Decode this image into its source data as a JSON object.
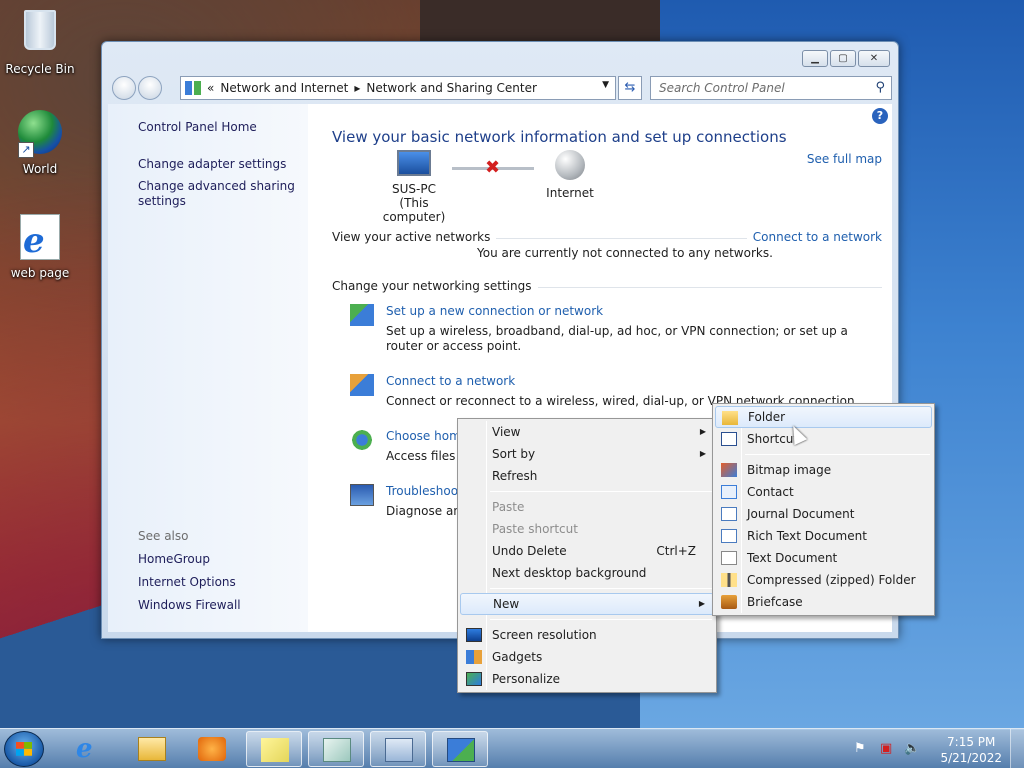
{
  "desktop": {
    "icons": [
      {
        "label": "Recycle Bin",
        "icon": "recycle-bin-icon"
      },
      {
        "label": "World",
        "icon": "globe-shortcut-icon"
      },
      {
        "label": "web page",
        "icon": "internet-explorer-document-icon"
      }
    ]
  },
  "window": {
    "breadcrumb": {
      "prefix": "«",
      "items": [
        "Network and Internet",
        "Network and Sharing Center"
      ],
      "separator": "▸"
    },
    "search_placeholder": "Search Control Panel",
    "left_links": [
      "Control Panel Home",
      "Change adapter settings",
      "Change advanced sharing settings"
    ],
    "see_also": {
      "heading": "See also",
      "links": [
        "HomeGroup",
        "Internet Options",
        "Windows Firewall"
      ]
    },
    "main": {
      "title": "View your basic network information and set up connections",
      "see_full_map": "See full map",
      "computer_name": "SUS-PC",
      "computer_sub": "(This computer)",
      "internet_label": "Internet",
      "active_networks_label": "View your active networks",
      "connect_link": "Connect to a network",
      "not_connected": "You are currently not connected to any networks.",
      "change_settings_label": "Change your networking settings",
      "tasks": [
        {
          "title": "Set up a new connection or network",
          "desc": "Set up a wireless, broadband, dial-up, ad hoc, or VPN connection; or set up a router or access point."
        },
        {
          "title": "Connect to a network",
          "desc": "Connect or reconnect to a wireless, wired, dial-up, or VPN network connection."
        },
        {
          "title": "Choose home",
          "desc": "Access files an"
        },
        {
          "title": "Troubleshoot",
          "desc": "Diagnose and"
        }
      ]
    }
  },
  "context_menu": {
    "items": [
      {
        "label": "View",
        "submenu": true
      },
      {
        "label": "Sort by",
        "submenu": true
      },
      {
        "label": "Refresh"
      },
      {
        "label": "Paste",
        "disabled": true
      },
      {
        "label": "Paste shortcut",
        "disabled": true
      },
      {
        "label": "Undo Delete",
        "shortcut": "Ctrl+Z"
      },
      {
        "label": "Next desktop background"
      },
      {
        "label": "New",
        "submenu": true,
        "highlighted": true
      },
      {
        "label": "Screen resolution",
        "icon": "screen-resolution-icon"
      },
      {
        "label": "Gadgets",
        "icon": "gadgets-icon"
      },
      {
        "label": "Personalize",
        "icon": "personalize-icon"
      }
    ]
  },
  "new_submenu": {
    "items": [
      {
        "label": "Folder",
        "icon": "folder-icon",
        "highlighted": true
      },
      {
        "label": "Shortcut",
        "icon": "shortcut-icon"
      },
      {
        "label": "Bitmap image",
        "icon": "bitmap-icon"
      },
      {
        "label": "Contact",
        "icon": "contact-icon"
      },
      {
        "label": "Journal Document",
        "icon": "journal-icon"
      },
      {
        "label": "Rich Text Document",
        "icon": "rich-text-icon"
      },
      {
        "label": "Text Document",
        "icon": "text-document-icon"
      },
      {
        "label": "Compressed (zipped) Folder",
        "icon": "zip-folder-icon"
      },
      {
        "label": "Briefcase",
        "icon": "briefcase-icon"
      }
    ]
  },
  "taskbar": {
    "pinned": [
      "internet-explorer-icon",
      "explorer-folder-icon",
      "media-player-icon",
      "sticky-notes-icon",
      "journal-icon",
      "control-panel-icon",
      "network-sharing-icon"
    ],
    "clock_time": "7:15 PM",
    "clock_date": "5/21/2022"
  },
  "colors": {
    "link": "#1f5fae",
    "title": "#1e3f8a",
    "error_x": "#d31f1f"
  }
}
